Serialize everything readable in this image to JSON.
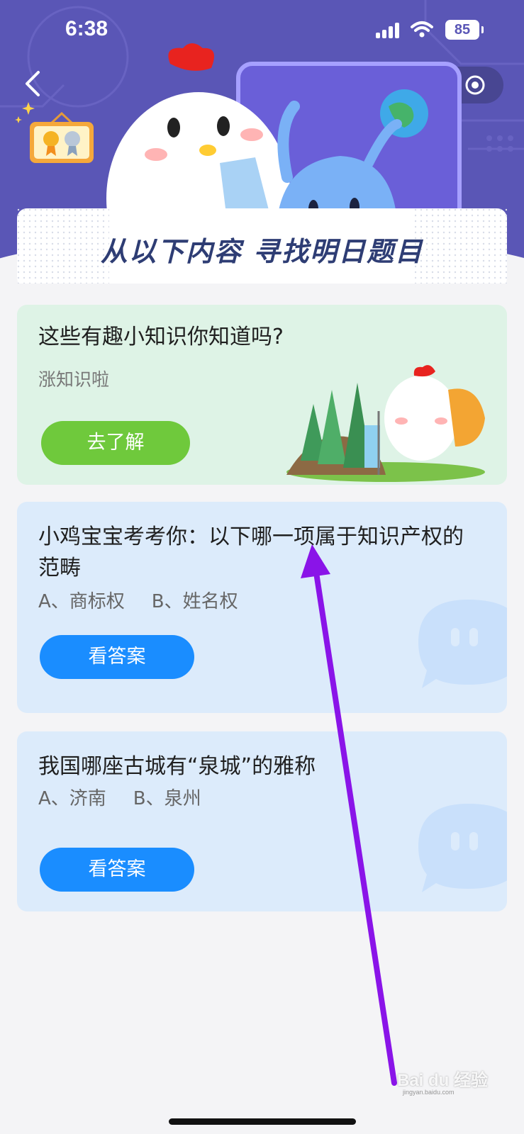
{
  "status_bar": {
    "time": "6:38",
    "battery": "85"
  },
  "header": {
    "banner_title": "从以下内容 寻找明日题目"
  },
  "cards": [
    {
      "title": "这些有趣小知识你知道吗?",
      "subtitle": "涨知识啦",
      "button": "去了解"
    },
    {
      "title": "小鸡宝宝考考你：以下哪一项属于知识产权的范畴",
      "option_a": "A、商标权",
      "option_b": "B、姓名权",
      "button": "看答案"
    },
    {
      "title": "我国哪座古城有“泉城”的雅称",
      "option_a": "A、济南",
      "option_b": "B、泉州",
      "button": "看答案"
    }
  ],
  "watermark": {
    "brand": "Bai du 经验",
    "url": "jingyan.baidu.com"
  },
  "colors": {
    "header_bg": "#5a56b6",
    "green_button": "#6fc93c",
    "blue_button": "#1a8dff",
    "annotation_arrow": "#8a14e8"
  },
  "icons": [
    "back-arrow-icon",
    "star-icon",
    "more-icon",
    "target-icon",
    "medal-icon",
    "chat-bubble-icon",
    "wifi-icon",
    "signal-icon"
  ]
}
